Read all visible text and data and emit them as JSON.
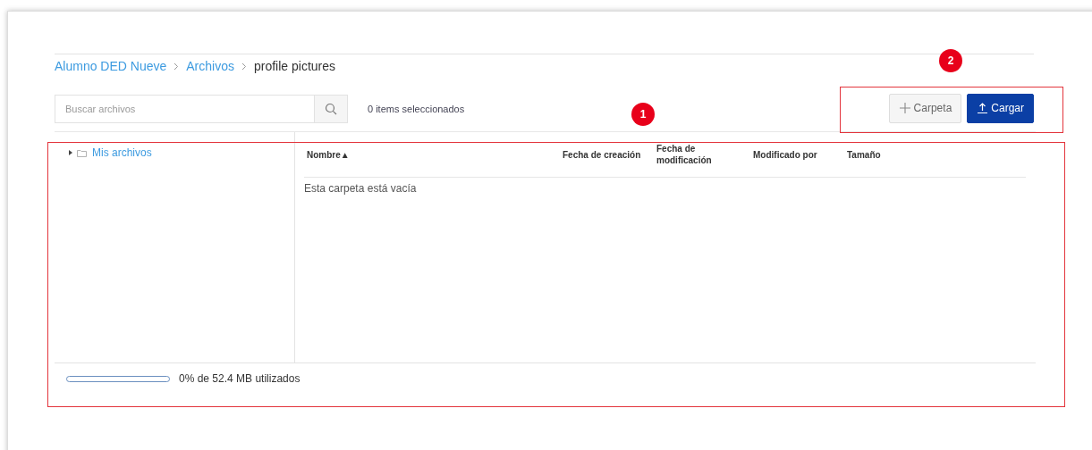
{
  "breadcrumb": [
    {
      "label": "Alumno DED Nueve",
      "link": true
    },
    {
      "label": "Archivos",
      "link": true
    },
    {
      "label": "profile pictures",
      "link": false
    }
  ],
  "search": {
    "placeholder": "Buscar archivos"
  },
  "selection_count": "0 items seleccionados",
  "buttons": [
    {
      "label": "Carpeta",
      "kind": "folder"
    },
    {
      "label": "Cargar",
      "kind": "upload"
    }
  ],
  "tree": [
    {
      "label": "Mis archivos",
      "expanded": false
    }
  ],
  "table": {
    "columns": [
      {
        "label": "Nombre",
        "sort": "▲"
      },
      {
        "label": "Fecha de creación"
      },
      {
        "label": "Fecha de modificación"
      },
      {
        "label": "Modificado por"
      },
      {
        "label": "Tamaño"
      }
    ],
    "empty_message": "Esta carpeta está vacía"
  },
  "usage": {
    "level": 0,
    "text": "0% de 52.4 MB utilizados"
  },
  "callouts": [
    {
      "number": "1"
    },
    {
      "number": "2"
    }
  ]
}
